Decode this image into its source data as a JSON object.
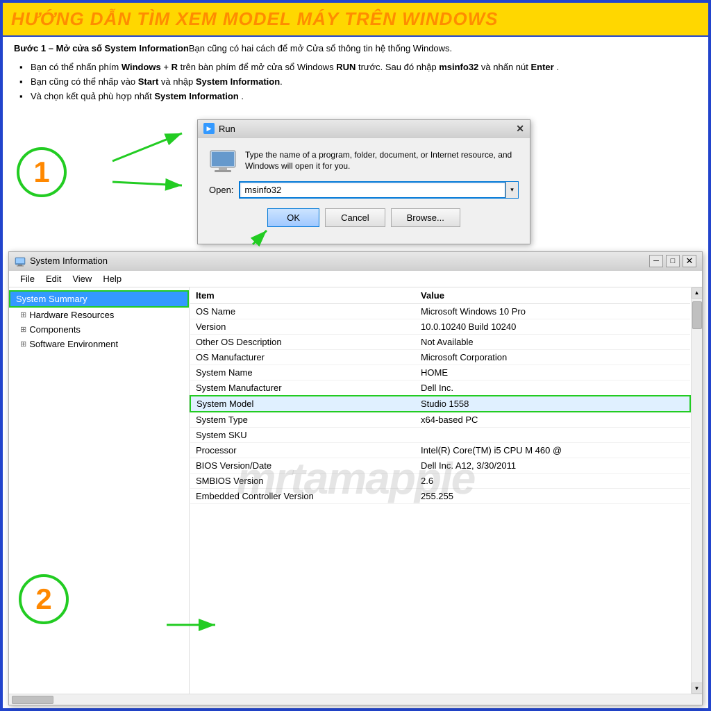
{
  "title": "HƯỚNG DẪN TÌM XEM MODEL MÁY TRÊN WINDOWS",
  "subtitle": {
    "step": "Bước 1 – Mở cửa số System Information",
    "desc": "Bạn cũng có hai cách để mở Cửa sổ thông tin hệ thống Windows."
  },
  "bullets": [
    "Bạn có thể nhấn phím Windows + R trên bàn phím để mở cửa sổ Windows RUN trước. Sau đó nhập msinfo32 và nhấn nút Enter .",
    "Bạn cũng có thể nhấp vào Start và nhập System Information.",
    "Và chọn kết quả phù hợp nhất System Information ."
  ],
  "run_dialog": {
    "title": "Run",
    "desc": "Type the name of a program, folder, document, or Internet resource, and Windows will open it for you.",
    "open_label": "Open:",
    "input_value": "msinfo32",
    "ok": "OK",
    "cancel": "Cancel",
    "browse": "Browse..."
  },
  "sysinfo_window": {
    "title": "System Information",
    "menus": [
      "File",
      "Edit",
      "View",
      "Help"
    ],
    "sidebar": {
      "selected": "System Summary",
      "items": [
        {
          "label": "Hardware Resources",
          "indent": 1
        },
        {
          "label": "Components",
          "indent": 1
        },
        {
          "label": "Software Environment",
          "indent": 1
        }
      ]
    },
    "table": {
      "headers": [
        "Item",
        "Value"
      ],
      "rows": [
        {
          "item": "OS Name",
          "value": "Microsoft Windows 10 Pro"
        },
        {
          "item": "Version",
          "value": "10.0.10240 Build 10240"
        },
        {
          "item": "Other OS Description",
          "value": "Not Available"
        },
        {
          "item": "OS Manufacturer",
          "value": "Microsoft Corporation"
        },
        {
          "item": "System Name",
          "value": "HOME"
        },
        {
          "item": "System Manufacturer",
          "value": "Dell Inc."
        },
        {
          "item": "System Model",
          "value": "Studio 1558",
          "highlighted": true
        },
        {
          "item": "System Type",
          "value": "x64-based PC"
        },
        {
          "item": "System SKU",
          "value": ""
        },
        {
          "item": "Processor",
          "value": "Intel(R) Core(TM) i5 CPU    M 460 @"
        },
        {
          "item": "BIOS Version/Date",
          "value": "Dell Inc. A12, 3/30/2011"
        },
        {
          "item": "SMBIOS Version",
          "value": "2.6"
        },
        {
          "item": "Embedded Controller Version",
          "value": "255.255"
        }
      ]
    }
  },
  "numbers": {
    "one": "1",
    "two": "2"
  },
  "watermark": "mrtamapple"
}
